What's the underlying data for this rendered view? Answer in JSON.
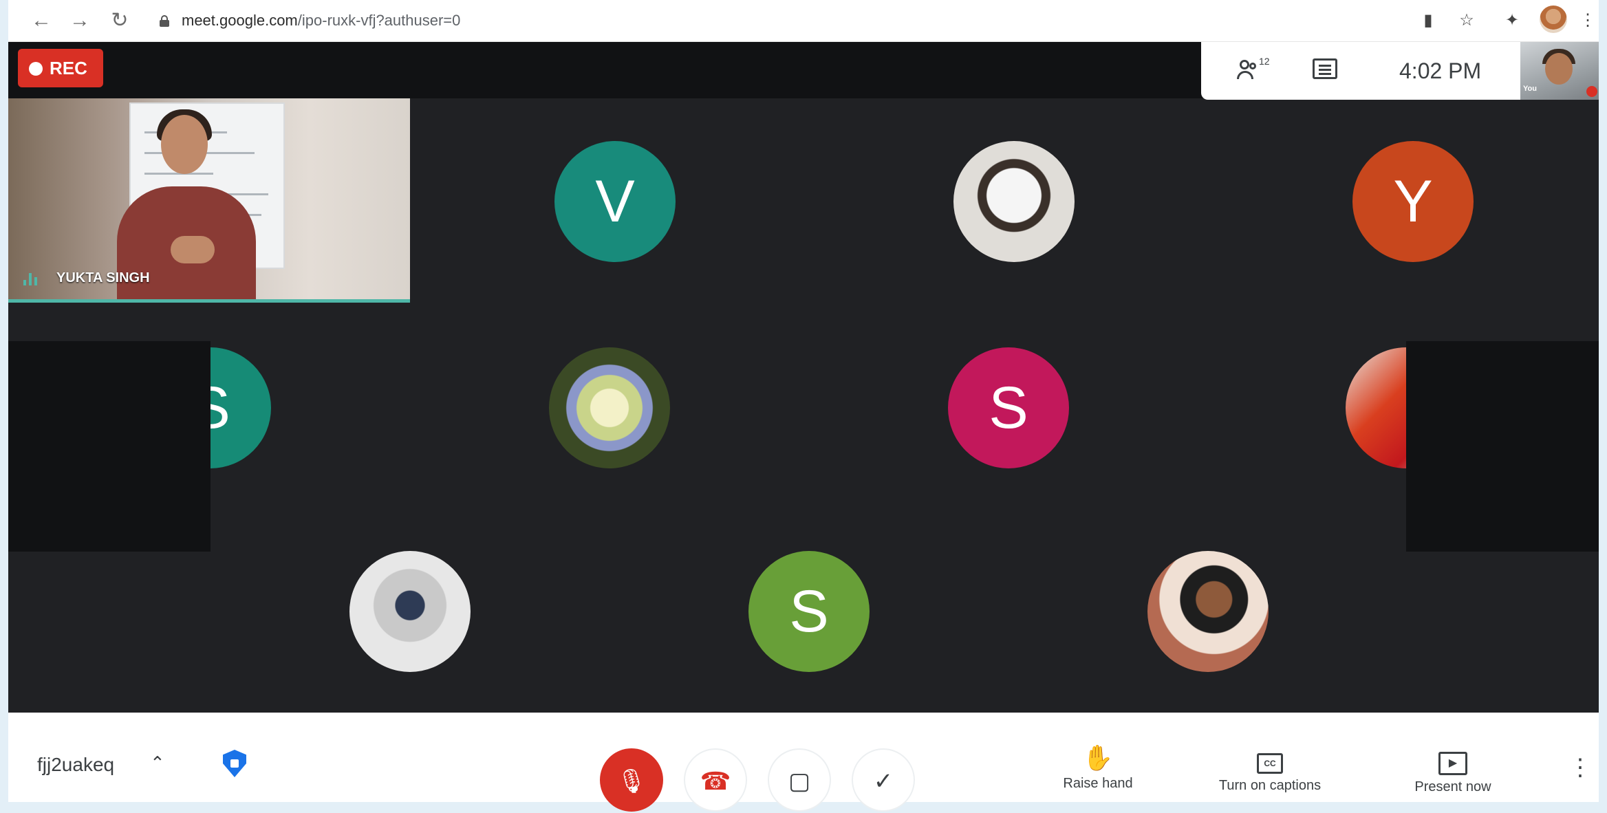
{
  "browser": {
    "url_host": "meet.google.com",
    "url_path": "/ipo-ruxk-vfj?authuser=0",
    "back_icon": "arrow-left-icon",
    "forward_icon": "arrow-right-icon",
    "reload_icon": "reload-icon"
  },
  "meeting": {
    "rec_label": "REC",
    "participant_count": "12",
    "time": "4:02  PM",
    "self_label": "You",
    "code": "fjj2uakeq"
  },
  "presenter": {
    "name": "YUKTA SINGH"
  },
  "participants": [
    {
      "initial": "V",
      "color": "#188b7b"
    },
    {
      "initial": "",
      "color": "#cfcfcf"
    },
    {
      "initial": "Y",
      "color": "#c8471d"
    },
    {
      "initial": "S",
      "color": "#168b76"
    },
    {
      "initial": "",
      "color": "#7b8a5a"
    },
    {
      "initial": "S",
      "color": "#c2185b"
    },
    {
      "initial": "",
      "color": "#d45a2a"
    },
    {
      "initial": "",
      "color": "#bdbdbd"
    },
    {
      "initial": "S",
      "color": "#689f38"
    },
    {
      "initial": "",
      "color": "#a39080"
    }
  ],
  "controls": {
    "raise_hand": "Raise hand",
    "captions": "Turn on captions",
    "present": "Present now"
  },
  "colors": {
    "accent": "#d93025",
    "stage": "#202124",
    "speaking": "#4fb7a8"
  }
}
